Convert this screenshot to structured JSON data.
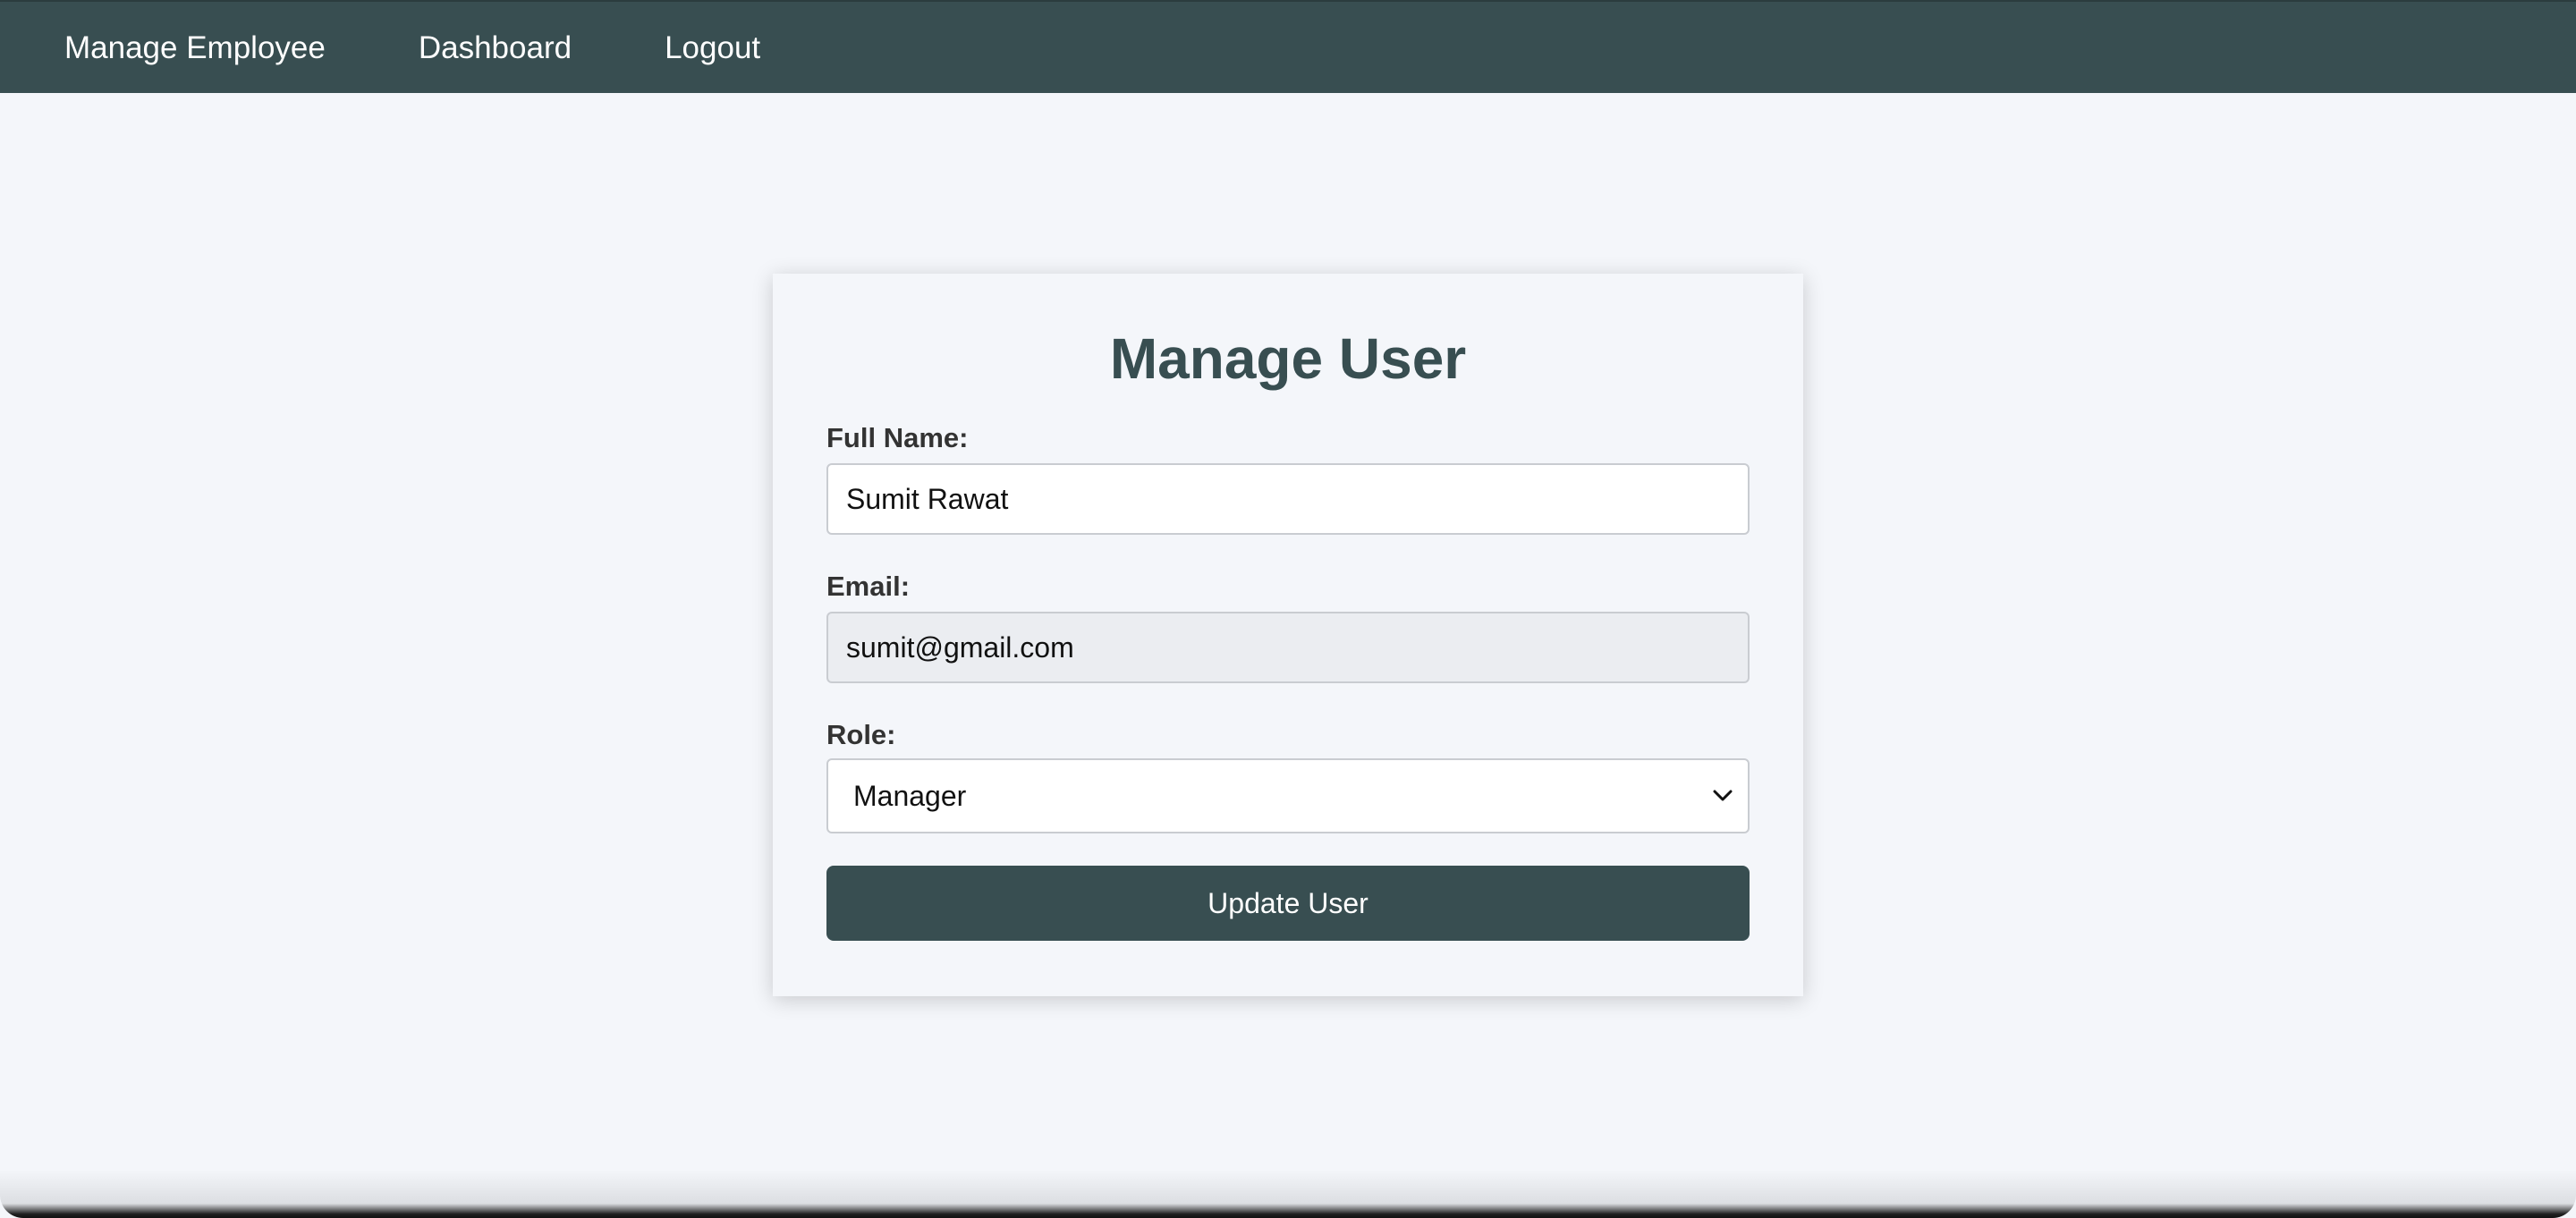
{
  "nav": {
    "items": [
      {
        "label": "Manage Employee"
      },
      {
        "label": "Dashboard"
      },
      {
        "label": "Logout"
      }
    ]
  },
  "form": {
    "title": "Manage User",
    "full_name": {
      "label": "Full Name:",
      "value": "Sumit Rawat"
    },
    "email": {
      "label": "Email:",
      "value": "sumit@gmail.com"
    },
    "role": {
      "label": "Role:",
      "value": "Manager"
    },
    "submit_label": "Update User"
  },
  "colors": {
    "navbar": "#384e51",
    "button": "#384e51",
    "title": "#384e51",
    "page_background": "#f4f6fa"
  },
  "icons": {
    "role_dropdown": "chevron-down-icon"
  }
}
